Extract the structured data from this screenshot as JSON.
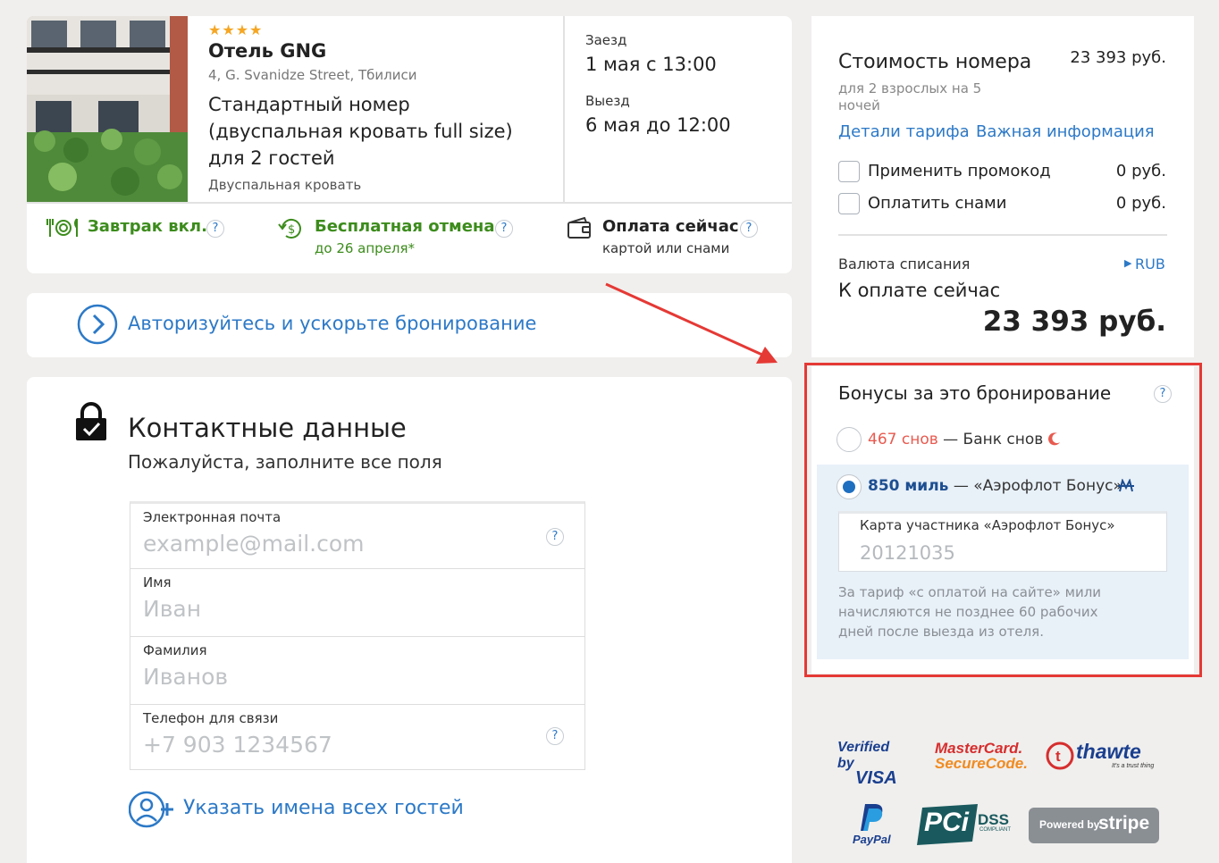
{
  "hotel": {
    "stars": "★★★★",
    "name": "Отель GNG",
    "address": "4, G. Svanidze Street, Тбилиси",
    "room_line1": "Стандартный номер",
    "room_line2": "(двуспальная кровать full size)",
    "room_line3": "для 2 гостей",
    "bed": "Двуспальная кровать"
  },
  "dates": {
    "checkin_label": "Заезд",
    "checkin_value": "1 мая с 13:00",
    "checkout_label": "Выезд",
    "checkout_value": "6 мая до 12:00"
  },
  "features": {
    "breakfast": "Завтрак вкл.",
    "cancel_title": "Бесплатная отмена",
    "cancel_sub": "до 26 апреля*",
    "pay_title": "Оплата сейчас",
    "pay_sub": "картой или снами",
    "help": "?"
  },
  "auth": {
    "text": "Авторизуйтесь и ускорьте бронирование"
  },
  "contacts": {
    "title": "Контактные данные",
    "subtitle": "Пожалуйста, заполните все поля",
    "email_label": "Электронная почта",
    "email_placeholder": "example@mail.com",
    "name_label": "Имя",
    "name_placeholder": "Иван",
    "surname_label": "Фамилия",
    "surname_placeholder": "Иванов",
    "phone_label": "Телефон для связи",
    "phone_placeholder": "+7 903 1234567",
    "guests_link": "Указать имена всех гостей"
  },
  "price": {
    "title": "Стоимость номера",
    "amount": "23 393 руб.",
    "desc": "для 2 взрослых  на 5 ночей",
    "details_link": "Детали тарифа",
    "dot": "·",
    "info_link": "Важная информация",
    "promo_label": "Применить промокод",
    "promo_value": "0 руб.",
    "pay_us_label": "Оплатить снами",
    "pay_us_value": "0 руб.",
    "currency_label": "Валюта списания",
    "currency_value": "RUB",
    "due_label": "К оплате сейчас",
    "due_amount": "23 393 руб."
  },
  "bonuses": {
    "title": "Бонусы за это бронирование",
    "option1_amount": "467 снов",
    "option1_rest": " — Банк снов",
    "option2_amount": "850 миль",
    "option2_rest": " — «Аэрофлот Бонус»",
    "card_label": "Карта участника «Аэрофлот Бонус»",
    "card_value": "20121035",
    "note": "За тариф «с оплатой на сайте» мили начисляются не позднее 60 рабочих дней после выезда из отеля.",
    "selected": "option2"
  },
  "logos": {
    "visa_top": "Verified by",
    "visa_bottom": "VISA",
    "mc_top": "MasterCard.",
    "mc_bottom": "SecureCode.",
    "thawte": "thawte",
    "thawte_sub": "It's a trust thing",
    "paypal": "PayPal",
    "pci": "PCi",
    "dss": "DSS",
    "dss_sub": "COMPLIANT",
    "stripe_pre": "Powered by",
    "stripe": "stripe"
  },
  "colors": {
    "accent": "#2c79c7",
    "green": "#3c8c1c",
    "highlight": "#e53935",
    "bonus_bg": "#e8f0f8",
    "dream": "#e85a4f"
  }
}
